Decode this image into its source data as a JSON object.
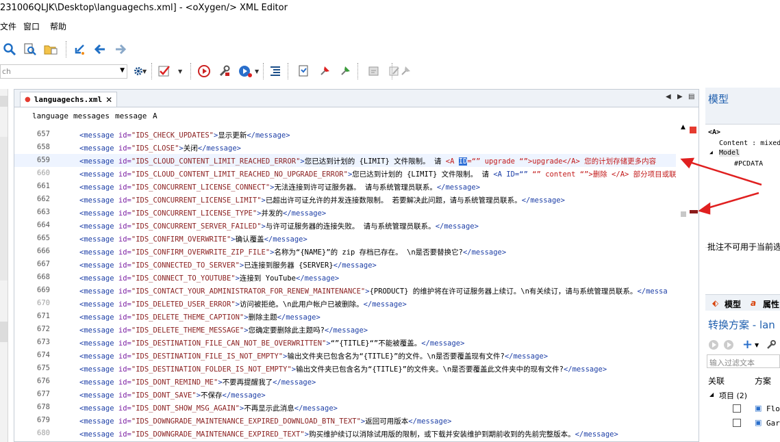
{
  "window": {
    "title": "231006QLJK\\Desktop\\languagechs.xml] - <oXygen/> XML Editor"
  },
  "menu": [
    "文件",
    "窗口",
    "帮助"
  ],
  "search_combo": {
    "value": "ch"
  },
  "tab": {
    "label": "languagechs.xml",
    "close": "✕"
  },
  "breadcrumb": [
    "language",
    "messages",
    "message",
    "A"
  ],
  "colors": {
    "tag": "#1c3ea6",
    "attr": "#7b1fa2",
    "value": "#8a1f1f",
    "red_text": "#c21a1a",
    "selection": "#2f6fd6",
    "arrow": "#e02020",
    "marker_top": "#e53b30",
    "marker_bottom": "#8b1a1a"
  },
  "lines": [
    {
      "n": "657",
      "t": [
        [
          "tg",
          "<message "
        ],
        [
          "at",
          "id="
        ],
        [
          "av",
          "\"IDS_CHECK_UPDATES\""
        ],
        [
          "tg",
          ">"
        ],
        [
          "tx",
          "显示更新"
        ],
        [
          "tg",
          "</message>"
        ]
      ]
    },
    {
      "n": "658",
      "t": [
        [
          "tg",
          "<message "
        ],
        [
          "at",
          "id="
        ],
        [
          "av",
          "\"IDS_CLOSE\""
        ],
        [
          "tg",
          ">"
        ],
        [
          "tx",
          "关闭"
        ],
        [
          "tg",
          "</message>"
        ]
      ]
    },
    {
      "n": "659",
      "cur": true,
      "t": [
        [
          "tg",
          "<message "
        ],
        [
          "at",
          "id="
        ],
        [
          "av",
          "\"IDS_CLOUD_CONTENT_LIMIT_REACHED_ERROR\""
        ],
        [
          "tg",
          ">"
        ],
        [
          "tx",
          "您已达到计划的 {LIMIT} 文件限制。 请 "
        ],
        [
          "tr",
          "<A "
        ],
        [
          "sel",
          "ID"
        ],
        [
          "tr",
          "=“” upgrade “”>upgrade</A> 您的计划存储更多内容"
        ]
      ]
    },
    {
      "n": "660",
      "grey": true,
      "t": [
        [
          "tg",
          "<message "
        ],
        [
          "at",
          "id="
        ],
        [
          "av",
          "\"IDS_CLOUD_CONTENT_LIMIT_REACHED_NO_UPGRADE_ERROR\""
        ],
        [
          "tg",
          ">"
        ],
        [
          "tx",
          "您已达到计划的 {LIMIT} 文件限制。 请 "
        ],
        [
          "tg",
          "<A ID=“” "
        ],
        [
          "tr",
          "“” content “”>删除 </A> 部分项目或联"
        ]
      ]
    },
    {
      "n": "661",
      "t": [
        [
          "tg",
          "<message "
        ],
        [
          "at",
          "id="
        ],
        [
          "av",
          "\"IDS_CONCURRENT_LICENSE_CONNECT\""
        ],
        [
          "tg",
          ">"
        ],
        [
          "tx",
          "无法连接到许可证服务器。 请与系统管理员联系。"
        ],
        [
          "tg",
          "</message>"
        ]
      ]
    },
    {
      "n": "662",
      "t": [
        [
          "tg",
          "<message "
        ],
        [
          "at",
          "id="
        ],
        [
          "av",
          "\"IDS_CONCURRENT_LICENSE_LIMIT\""
        ],
        [
          "tg",
          ">"
        ],
        [
          "tx",
          "已超出许可证允许的并发连接数限制。 若要解决此问题，请与系统管理员联系。"
        ],
        [
          "tg",
          "</message>"
        ]
      ]
    },
    {
      "n": "663",
      "t": [
        [
          "tg",
          "<message "
        ],
        [
          "at",
          "id="
        ],
        [
          "av",
          "\"IDS_CONCURRENT_LICENSE_TYPE\""
        ],
        [
          "tg",
          ">"
        ],
        [
          "tx",
          "并发的"
        ],
        [
          "tg",
          "</message>"
        ]
      ]
    },
    {
      "n": "664",
      "t": [
        [
          "tg",
          "<message "
        ],
        [
          "at",
          "id="
        ],
        [
          "av",
          "\"IDS_CONCURRENT_SERVER_FAILED\""
        ],
        [
          "tg",
          ">"
        ],
        [
          "tx",
          "与许可证服务器的连接失败。 请与系统管理员联系。"
        ],
        [
          "tg",
          "</message>"
        ]
      ]
    },
    {
      "n": "665",
      "t": [
        [
          "tg",
          "<message "
        ],
        [
          "at",
          "id="
        ],
        [
          "av",
          "\"IDS_CONFIRM_OVERWRITE\""
        ],
        [
          "tg",
          ">"
        ],
        [
          "tx",
          "确认覆盖"
        ],
        [
          "tg",
          "</message>"
        ]
      ]
    },
    {
      "n": "666",
      "t": [
        [
          "tg",
          "<message "
        ],
        [
          "at",
          "id="
        ],
        [
          "av",
          "\"IDS_CONFIRM_OVERWRITE_ZIP_FILE\""
        ],
        [
          "tg",
          ">"
        ],
        [
          "tx",
          "名称为“{NAME}”的 zip 存档已存在。 \\n是否要替换它?"
        ],
        [
          "tg",
          "</message>"
        ]
      ]
    },
    {
      "n": "667",
      "t": [
        [
          "tg",
          "<message "
        ],
        [
          "at",
          "id="
        ],
        [
          "av",
          "\"IDS_CONNECTED_TO_SERVER\""
        ],
        [
          "tg",
          ">"
        ],
        [
          "tx",
          "已连接到服务器 {SERVER}"
        ],
        [
          "tg",
          "</message>"
        ]
      ]
    },
    {
      "n": "668",
      "t": [
        [
          "tg",
          "<message "
        ],
        [
          "at",
          "id="
        ],
        [
          "av",
          "\"IDS_CONNECT_TO_YOUTUBE\""
        ],
        [
          "tg",
          ">"
        ],
        [
          "tx",
          "连接到 YouTube"
        ],
        [
          "tg",
          "</message>"
        ]
      ]
    },
    {
      "n": "669",
      "t": [
        [
          "tg",
          "<message "
        ],
        [
          "at",
          "id="
        ],
        [
          "av",
          "\"IDS_CONTACT_YOUR_ADMINISTRATOR_FOR_RENEW_MAINTENANCE\""
        ],
        [
          "tg",
          ">"
        ],
        [
          "tx",
          "{PRODUCT} 的维护将在许可证服务器上续订。\\n有关续订，请与系统管理员联系。"
        ],
        [
          "tg",
          "</messa"
        ]
      ]
    },
    {
      "n": "670",
      "grey": true,
      "t": [
        [
          "tg",
          "<message "
        ],
        [
          "at",
          "id="
        ],
        [
          "av",
          "\"IDS_DELETED_USER_ERROR\""
        ],
        [
          "tg",
          ">"
        ],
        [
          "tx",
          "访问被拒绝。\\n此用户帐户已被删除。"
        ],
        [
          "tg",
          "</message>"
        ]
      ]
    },
    {
      "n": "671",
      "t": [
        [
          "tg",
          "<message "
        ],
        [
          "at",
          "id="
        ],
        [
          "av",
          "\"IDS_DELETE_THEME_CAPTION\""
        ],
        [
          "tg",
          ">"
        ],
        [
          "tx",
          "删除主题"
        ],
        [
          "tg",
          "</message>"
        ]
      ]
    },
    {
      "n": "672",
      "t": [
        [
          "tg",
          "<message "
        ],
        [
          "at",
          "id="
        ],
        [
          "av",
          "\"IDS_DELETE_THEME_MESSAGE\""
        ],
        [
          "tg",
          ">"
        ],
        [
          "tx",
          "您确定要删除此主题吗?"
        ],
        [
          "tg",
          "</message>"
        ]
      ]
    },
    {
      "n": "673",
      "t": [
        [
          "tg",
          "<message "
        ],
        [
          "at",
          "id="
        ],
        [
          "av",
          "\"IDS_DESTINATION_FILE_CAN_NOT_BE_OVERWRITTEN\""
        ],
        [
          "tg",
          ">"
        ],
        [
          "tx",
          "“”{TITLE}“”不能被覆盖。"
        ],
        [
          "tg",
          "</message>"
        ]
      ]
    },
    {
      "n": "674",
      "t": [
        [
          "tg",
          "<message "
        ],
        [
          "at",
          "id="
        ],
        [
          "av",
          "\"IDS_DESTINATION_FILE_IS_NOT_EMPTY\""
        ],
        [
          "tg",
          ">"
        ],
        [
          "tx",
          "输出文件夹已包含名为“{TITLE}”的文件。\\n是否要覆盖现有文件?"
        ],
        [
          "tg",
          "</message>"
        ]
      ]
    },
    {
      "n": "675",
      "t": [
        [
          "tg",
          "<message "
        ],
        [
          "at",
          "id="
        ],
        [
          "av",
          "\"IDS_DESTINATION_FOLDER_IS_NOT_EMPTY\""
        ],
        [
          "tg",
          ">"
        ],
        [
          "tx",
          "输出文件夹已包含名为“{TITLE}”的文件夹。\\n是否要覆盖此文件夹中的现有文件?"
        ],
        [
          "tg",
          "</message>"
        ]
      ]
    },
    {
      "n": "676",
      "t": [
        [
          "tg",
          "<message "
        ],
        [
          "at",
          "id="
        ],
        [
          "av",
          "\"IDS_DONT_REMIND_ME\""
        ],
        [
          "tg",
          ">"
        ],
        [
          "tx",
          "不要再提醒我了"
        ],
        [
          "tg",
          "</message>"
        ]
      ]
    },
    {
      "n": "677",
      "t": [
        [
          "tg",
          "<message "
        ],
        [
          "at",
          "id="
        ],
        [
          "av",
          "\"IDS_DONT_SAVE\""
        ],
        [
          "tg",
          ">"
        ],
        [
          "tx",
          "不保存"
        ],
        [
          "tg",
          "</message>"
        ]
      ]
    },
    {
      "n": "678",
      "t": [
        [
          "tg",
          "<message "
        ],
        [
          "at",
          "id="
        ],
        [
          "av",
          "\"IDS_DONT_SHOW_MSG_AGAIN\""
        ],
        [
          "tg",
          ">"
        ],
        [
          "tx",
          "不再显示此消息"
        ],
        [
          "tg",
          "</message>"
        ]
      ]
    },
    {
      "n": "679",
      "t": [
        [
          "tg",
          "<message "
        ],
        [
          "at",
          "id="
        ],
        [
          "av",
          "\"IDS_DOWNGRADE_MAINTENANCE_EXPIRED_DOWNLOAD_BTN_TEXT\""
        ],
        [
          "tg",
          ">"
        ],
        [
          "tx",
          "返回可用版本"
        ],
        [
          "tg",
          "</message>"
        ]
      ]
    },
    {
      "n": "680",
      "grey": true,
      "t": [
        [
          "tg",
          "<message "
        ],
        [
          "at",
          "id="
        ],
        [
          "av",
          "\"IDS_DOWNGRADE_MAINTENANCE_EXPIRED_TEXT\""
        ],
        [
          "tg",
          ">"
        ],
        [
          "tx",
          "购买维护续订以消除试用版的限制，或下载并安装维护到期前收到的先前完整版本。"
        ],
        [
          "tg",
          "</message>"
        ]
      ]
    }
  ],
  "model_panel": {
    "title": "模型",
    "element": "<A>",
    "content_label": "Content : mixed",
    "model_label": "Model",
    "pcdata": "#PCDATA",
    "note": "批注不可用于当前选"
  },
  "panel_tabs": {
    "model": "模型",
    "attributes": "属性"
  },
  "scenarios": {
    "title": "转换方案 - lan",
    "filter_placeholder": "输入过滤文本",
    "col_assoc": "关联",
    "col_scenario": "方案",
    "group": "项目 (2)",
    "items": [
      "Flo",
      "Gar"
    ]
  }
}
